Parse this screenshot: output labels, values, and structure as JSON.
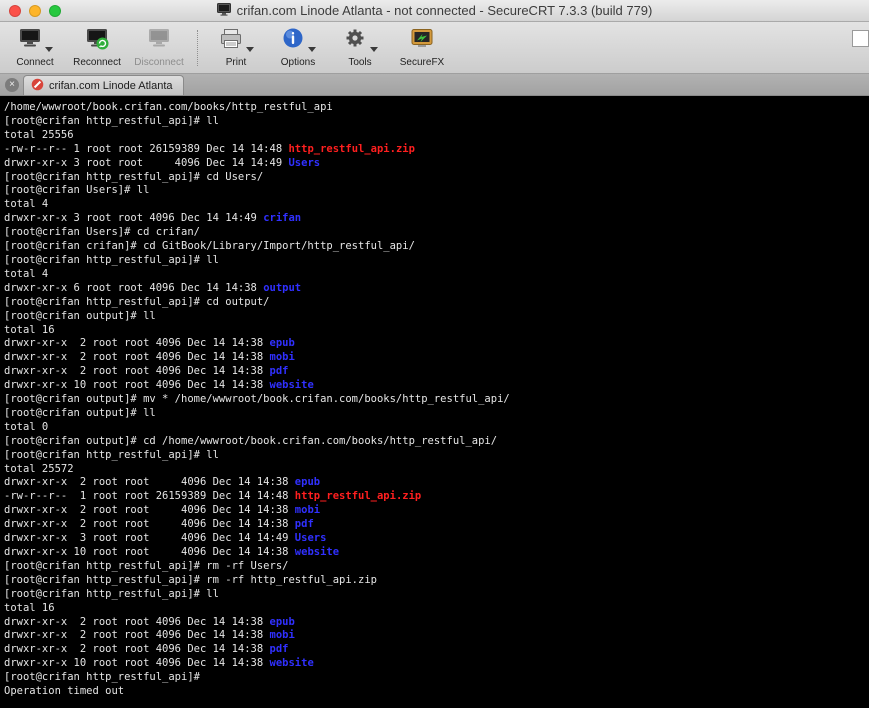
{
  "window": {
    "title": "crifan.com Linode Atlanta - not connected - SecureCRT 7.3.3 (build 779)"
  },
  "toolbar": {
    "buttons": [
      {
        "label": "Connect"
      },
      {
        "label": "Reconnect"
      },
      {
        "label": "Disconnect"
      },
      {
        "label": "Print"
      },
      {
        "label": "Options"
      },
      {
        "label": "Tools"
      },
      {
        "label": "SecureFX"
      }
    ]
  },
  "tabbar": {
    "close_all_glyph": "×",
    "tab_label": "crifan.com Linode Atlanta"
  },
  "colors": {
    "terminal_bg": "#000000",
    "terminal_fg": "#e6e6e6",
    "directory_blue": "#3030ff",
    "archive_red": "#ff1f1f"
  },
  "terminal": {
    "lines": [
      [
        [
          "/home/wwwroot/book.crifan.com/books/http_restful_api",
          "w"
        ]
      ],
      [
        [
          "[root@crifan http_restful_api]# ll",
          "w"
        ]
      ],
      [
        [
          "total 25556",
          "w"
        ]
      ],
      [
        [
          "-rw-r--r-- 1 root root 26159389 Dec 14 14:48 ",
          "w"
        ],
        [
          "http_restful_api.zip",
          "r"
        ]
      ],
      [
        [
          "drwxr-xr-x 3 root root     4096 Dec 14 14:49 ",
          "w"
        ],
        [
          "Users",
          "b"
        ]
      ],
      [
        [
          "[root@crifan http_restful_api]# cd Users/",
          "w"
        ]
      ],
      [
        [
          "[root@crifan Users]# ll",
          "w"
        ]
      ],
      [
        [
          "total 4",
          "w"
        ]
      ],
      [
        [
          "drwxr-xr-x 3 root root 4096 Dec 14 14:49 ",
          "w"
        ],
        [
          "crifan",
          "b"
        ]
      ],
      [
        [
          "[root@crifan Users]# cd crifan/",
          "w"
        ]
      ],
      [
        [
          "[root@crifan crifan]# cd GitBook/Library/Import/http_restful_api/",
          "w"
        ]
      ],
      [
        [
          "[root@crifan http_restful_api]# ll",
          "w"
        ]
      ],
      [
        [
          "total 4",
          "w"
        ]
      ],
      [
        [
          "drwxr-xr-x 6 root root 4096 Dec 14 14:38 ",
          "w"
        ],
        [
          "output",
          "b"
        ]
      ],
      [
        [
          "[root@crifan http_restful_api]# cd output/",
          "w"
        ]
      ],
      [
        [
          "[root@crifan output]# ll",
          "w"
        ]
      ],
      [
        [
          "total 16",
          "w"
        ]
      ],
      [
        [
          "drwxr-xr-x  2 root root 4096 Dec 14 14:38 ",
          "w"
        ],
        [
          "epub",
          "b"
        ]
      ],
      [
        [
          "drwxr-xr-x  2 root root 4096 Dec 14 14:38 ",
          "w"
        ],
        [
          "mobi",
          "b"
        ]
      ],
      [
        [
          "drwxr-xr-x  2 root root 4096 Dec 14 14:38 ",
          "w"
        ],
        [
          "pdf",
          "b"
        ]
      ],
      [
        [
          "drwxr-xr-x 10 root root 4096 Dec 14 14:38 ",
          "w"
        ],
        [
          "website",
          "b"
        ]
      ],
      [
        [
          "[root@crifan output]# mv * /home/wwwroot/book.crifan.com/books/http_restful_api/",
          "w"
        ]
      ],
      [
        [
          "[root@crifan output]# ll",
          "w"
        ]
      ],
      [
        [
          "total 0",
          "w"
        ]
      ],
      [
        [
          "[root@crifan output]# cd /home/wwwroot/book.crifan.com/books/http_restful_api/",
          "w"
        ]
      ],
      [
        [
          "[root@crifan http_restful_api]# ll",
          "w"
        ]
      ],
      [
        [
          "total 25572",
          "w"
        ]
      ],
      [
        [
          "drwxr-xr-x  2 root root     4096 Dec 14 14:38 ",
          "w"
        ],
        [
          "epub",
          "b"
        ]
      ],
      [
        [
          "-rw-r--r--  1 root root 26159389 Dec 14 14:48 ",
          "w"
        ],
        [
          "http_restful_api.zip",
          "r"
        ]
      ],
      [
        [
          "drwxr-xr-x  2 root root     4096 Dec 14 14:38 ",
          "w"
        ],
        [
          "mobi",
          "b"
        ]
      ],
      [
        [
          "drwxr-xr-x  2 root root     4096 Dec 14 14:38 ",
          "w"
        ],
        [
          "pdf",
          "b"
        ]
      ],
      [
        [
          "drwxr-xr-x  3 root root     4096 Dec 14 14:49 ",
          "w"
        ],
        [
          "Users",
          "b"
        ]
      ],
      [
        [
          "drwxr-xr-x 10 root root     4096 Dec 14 14:38 ",
          "w"
        ],
        [
          "website",
          "b"
        ]
      ],
      [
        [
          "[root@crifan http_restful_api]# rm -rf Users/",
          "w"
        ]
      ],
      [
        [
          "[root@crifan http_restful_api]# rm -rf http_restful_api.zip",
          "w"
        ]
      ],
      [
        [
          "[root@crifan http_restful_api]# ll",
          "w"
        ]
      ],
      [
        [
          "total 16",
          "w"
        ]
      ],
      [
        [
          "drwxr-xr-x  2 root root 4096 Dec 14 14:38 ",
          "w"
        ],
        [
          "epub",
          "b"
        ]
      ],
      [
        [
          "drwxr-xr-x  2 root root 4096 Dec 14 14:38 ",
          "w"
        ],
        [
          "mobi",
          "b"
        ]
      ],
      [
        [
          "drwxr-xr-x  2 root root 4096 Dec 14 14:38 ",
          "w"
        ],
        [
          "pdf",
          "b"
        ]
      ],
      [
        [
          "drwxr-xr-x 10 root root 4096 Dec 14 14:38 ",
          "w"
        ],
        [
          "website",
          "b"
        ]
      ],
      [
        [
          "[root@crifan http_restful_api]#",
          "w"
        ]
      ],
      [
        [
          "Operation timed out",
          "w"
        ]
      ]
    ]
  }
}
